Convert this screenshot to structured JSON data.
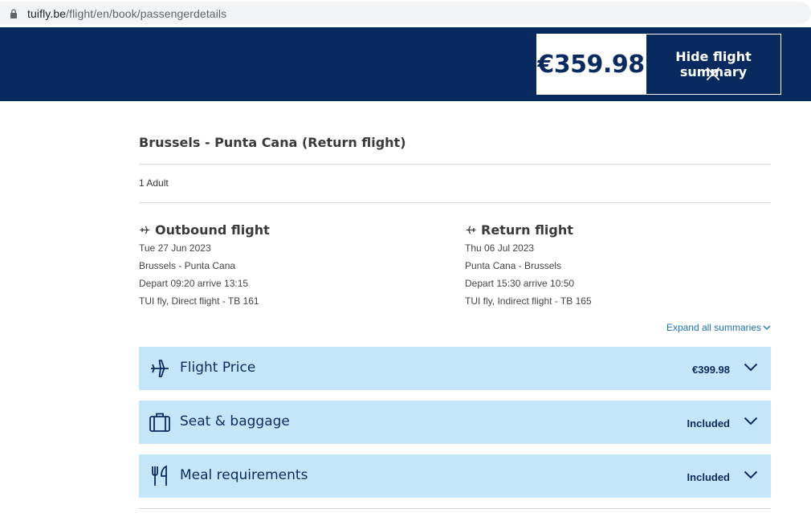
{
  "address_bar": {
    "host": "tuifly.be",
    "path": "/flight/en/book/passengerdetails"
  },
  "header": {
    "total_price": "€359.98",
    "hide_summary_label": "Hide flight summary"
  },
  "summary": {
    "route_title": "Brussels - Punta Cana (Return flight)",
    "passengers": "1 Adult",
    "outbound": {
      "heading": "Outbound flight",
      "date": "Tue 27 Jun 2023",
      "route": "Brussels - Punta Cana",
      "times": "Depart 09:20 arrive 13:15",
      "carrier": "TUI fly, Direct flight - TB 161"
    },
    "return": {
      "heading": "Return flight",
      "date": "Thu 06 Jul 2023",
      "route": "Punta Cana - Brussels",
      "times": "Depart 15:30 arrive 10:50",
      "carrier": "TUI fly, Indirect flight - TB 165"
    },
    "expand_all_label": "Expand all summaries"
  },
  "accordions": [
    {
      "title": "Flight Price",
      "value": "€399.98",
      "icon": "plane-icon"
    },
    {
      "title": "Seat & baggage",
      "value": "Included",
      "icon": "suitcase-icon"
    },
    {
      "title": "Meal requirements",
      "value": "Included",
      "icon": "cutlery-icon"
    }
  ],
  "colors": {
    "brand_navy": "#092a5e",
    "accordion_bg": "#c5e6f9",
    "link_blue": "#1f6fb0"
  }
}
